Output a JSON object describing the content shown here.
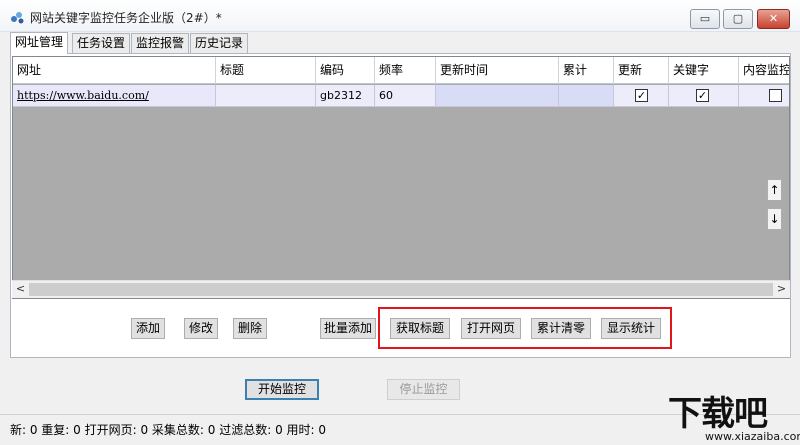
{
  "window": {
    "title": "网站关键字监控任务企业版（2#）*",
    "controls": {
      "minimize": "▭",
      "maximize": "▢",
      "close": "✕"
    }
  },
  "tabs": [
    {
      "label": "网址管理",
      "active": true
    },
    {
      "label": "任务设置",
      "active": false
    },
    {
      "label": "监控报警",
      "active": false
    },
    {
      "label": "历史记录",
      "active": false
    }
  ],
  "grid": {
    "columns": [
      "网址",
      "标题",
      "编码",
      "频率",
      "更新时间",
      "累计",
      "更新",
      "关键字",
      "内容监控"
    ],
    "rows": [
      {
        "url": "https://www.baidu.com/",
        "title": "",
        "encoding": "gb2312",
        "frequency": "60",
        "update_time": "",
        "total": "",
        "update": true,
        "keyword": true,
        "content": false
      }
    ],
    "side_buttons": {
      "up": "↑",
      "down": "↓"
    },
    "scroll": {
      "left": "<",
      "right": ">"
    }
  },
  "buttons": {
    "add": "添加",
    "edit": "修改",
    "delete": "删除",
    "batch_add": "批量添加",
    "get_title": "获取标题",
    "open_page": "打开网页",
    "clear_total": "累计清零",
    "show_stats": "显示统计",
    "start": "开始监控",
    "stop": "停止监控"
  },
  "status": {
    "text": "新: 0  重复: 0  打开网页: 0  采集总数: 0  过滤总数: 0  用时: 0"
  },
  "watermark": {
    "big": "下载吧",
    "small": "www.xiazaiba.com"
  },
  "colors": {
    "highlight": "#e1161b",
    "row_bg": "#f0f0ff",
    "grid_bg": "#ababab"
  }
}
